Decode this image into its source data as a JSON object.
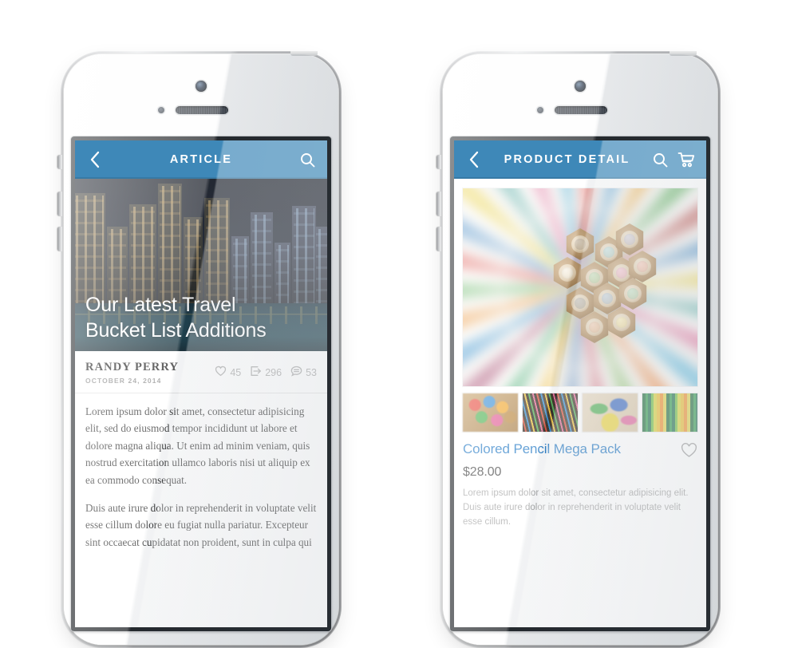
{
  "scene": {
    "background_color": "#ffffff",
    "device": "white-smartphone-mockup",
    "device_count": 2
  },
  "theme": {
    "nav_blue": "#3e88b8",
    "nav_blue_glare": "#8cb8d4",
    "link_blue": "#1f77c4",
    "muted_gray": "#a2a2a2",
    "screen_bezel": "#14181c"
  },
  "article_phone": {
    "navbar": {
      "back_icon": "chevron-left-icon",
      "title": "ARTICLE",
      "search_icon": "search-icon"
    },
    "hero": {
      "image_description": "night city skyline with lit skyscrapers over water",
      "title_line_1": "Our Latest Travel",
      "title_line_2": "Bucket List Additions"
    },
    "meta": {
      "author": "RANDY PERRY",
      "date": "OCTOBER 24, 2014",
      "stats": [
        {
          "icon": "heart-icon",
          "value": "45"
        },
        {
          "icon": "share-icon",
          "value": "296"
        },
        {
          "icon": "comment-icon",
          "value": "53"
        }
      ]
    },
    "body": {
      "paragraph_1": "Lorem ipsum dolor sit amet, consectetur adipisicing elit, sed do eiusmod tempor incididunt ut labore et dolore magna aliqua. Ut enim ad minim veniam, quis nostrud exercitation ullamco laboris nisi ut aliquip ex ea commodo consequat.",
      "paragraph_2": "Duis aute irure dolor in reprehenderit in voluptate velit esse cillum dolore eu fugiat nulla pariatur. Excepteur sint occaecat cupidatat non proident, sunt in culpa qui"
    }
  },
  "product_phone": {
    "navbar": {
      "back_icon": "chevron-left-icon",
      "title": "PRODUCT DETAIL",
      "search_icon": "search-icon",
      "cart_icon": "shopping-cart-icon"
    },
    "gallery": {
      "main_image_description": "overhead view of a cluster of sharpened colored pencil tips",
      "thumbnails": [
        {
          "label": "colored pencil tips cluster"
        },
        {
          "label": "colored pencil points close up"
        },
        {
          "label": "sharpened colored pencils"
        },
        {
          "label": "colored pencil barrels stripes"
        }
      ]
    },
    "product": {
      "title": "Colored Pencil Mega Pack",
      "price": "$28.00",
      "favorite_icon": "heart-outline-icon",
      "description": "Lorem ipsum dolor sit amet, consectetur adipisicing elit. Duis aute irure dolor in reprehenderit in voluptate velit esse cillum."
    }
  }
}
